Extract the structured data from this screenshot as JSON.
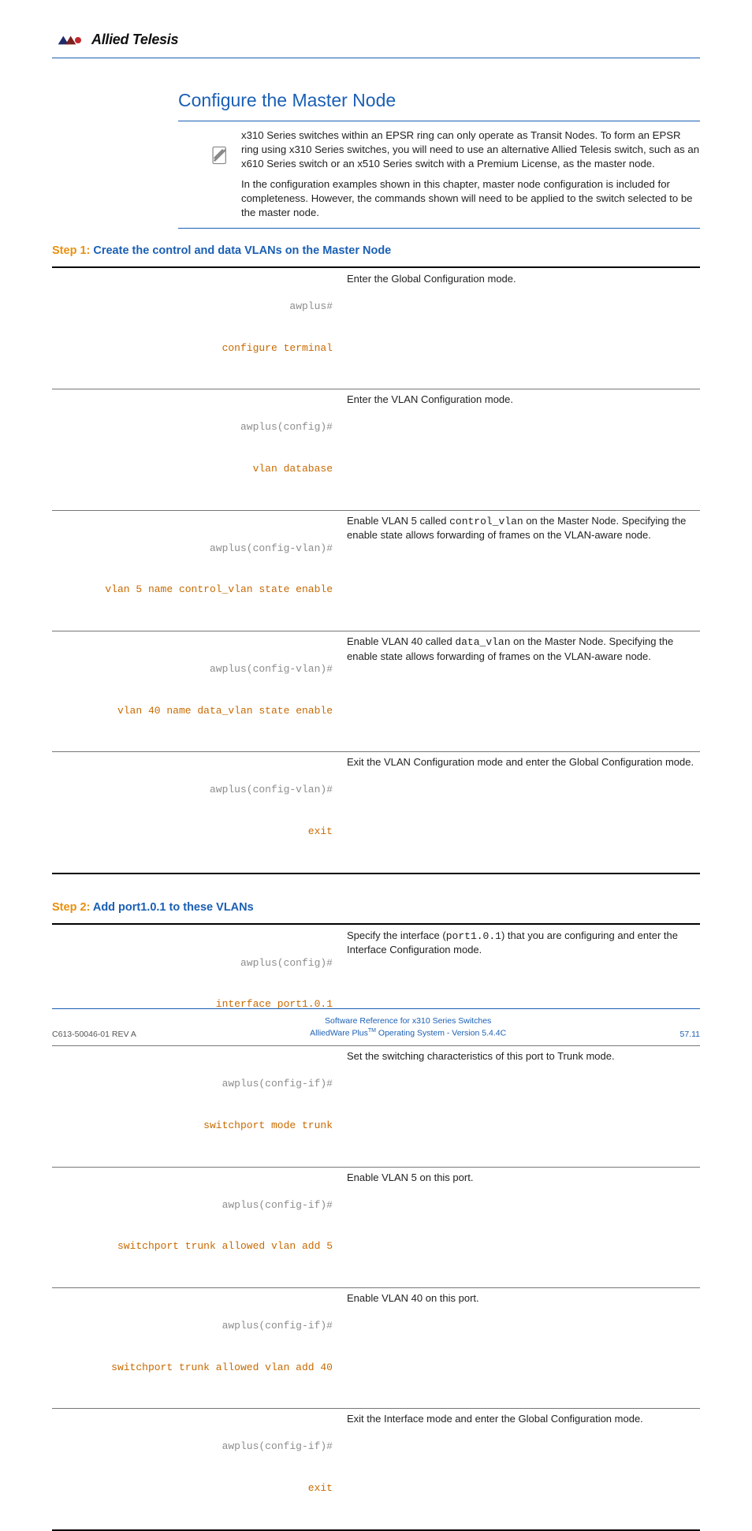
{
  "header": {
    "brand": "Allied Telesis"
  },
  "title": "Configure the Master Node",
  "note": {
    "p1": "x310 Series switches within an EPSR ring can only operate as Transit Nodes. To form an EPSR ring using x310 Series switches, you will need to use an alternative Allied Telesis switch, such as an x610 Series switch or an x510 Series switch with a Premium License, as the master node.",
    "p2": "In the configuration examples shown in this chapter, master node configuration is included for completeness. However, the commands shown will need to be applied to the switch selected to be the master node."
  },
  "step1": {
    "label": "Step 1: ",
    "desc": "Create the control and data VLANs on the Master Node",
    "rows": [
      {
        "prompt": "awplus#",
        "cmd": "configure terminal",
        "expl": "Enter the Global Configuration mode."
      },
      {
        "prompt": "awplus(config)#",
        "cmd": "vlan database",
        "expl": "Enter the VLAN Configuration mode."
      },
      {
        "prompt": "awplus(config-vlan)#",
        "cmd": "vlan 5 name control_vlan state enable",
        "expl_pre": "Enable VLAN 5 called ",
        "expl_code": "control_vlan",
        "expl_post": " on the Master Node. Specifying the enable state allows forwarding of frames on the VLAN-aware node."
      },
      {
        "prompt": "awplus(config-vlan)#",
        "cmd": "vlan 40 name data_vlan state enable",
        "expl_pre": "Enable VLAN 40 called ",
        "expl_code": "data_vlan",
        "expl_post": " on the Master Node. Specifying the enable state allows forwarding of frames on the VLAN-aware node."
      },
      {
        "prompt": "awplus(config-vlan)#",
        "cmd": "exit",
        "expl": "Exit the VLAN Configuration mode and enter the Global Configuration mode."
      }
    ]
  },
  "step2": {
    "label": "Step 2: ",
    "desc": "Add port1.0.1 to these VLANs",
    "rows": [
      {
        "prompt": "awplus(config)#",
        "cmd": "interface port1.0.1",
        "expl_pre": "Specify the interface (",
        "expl_code": "port1.0.1",
        "expl_post": ") that you are configuring and enter the Interface Configuration mode."
      },
      {
        "prompt": "awplus(config-if)#",
        "cmd": "switchport mode trunk",
        "expl": "Set the switching characteristics of this port to Trunk mode."
      },
      {
        "prompt": "awplus(config-if)#",
        "cmd": "switchport trunk allowed vlan add 5",
        "expl": "Enable VLAN 5 on this port."
      },
      {
        "prompt": "awplus(config-if)#",
        "cmd": "switchport trunk allowed vlan add 40",
        "expl": "Enable VLAN 40 on this port."
      },
      {
        "prompt": "awplus(config-if)#",
        "cmd": "exit",
        "expl": "Exit the Interface mode and enter the Global Configuration mode."
      }
    ]
  },
  "footer": {
    "left": "C613-50046-01 REV A",
    "center1": "Software Reference for x310 Series Switches",
    "center2a": "AlliedWare Plus",
    "center2b": " Operating System - Version 5.4.4C",
    "right": "57.11"
  }
}
